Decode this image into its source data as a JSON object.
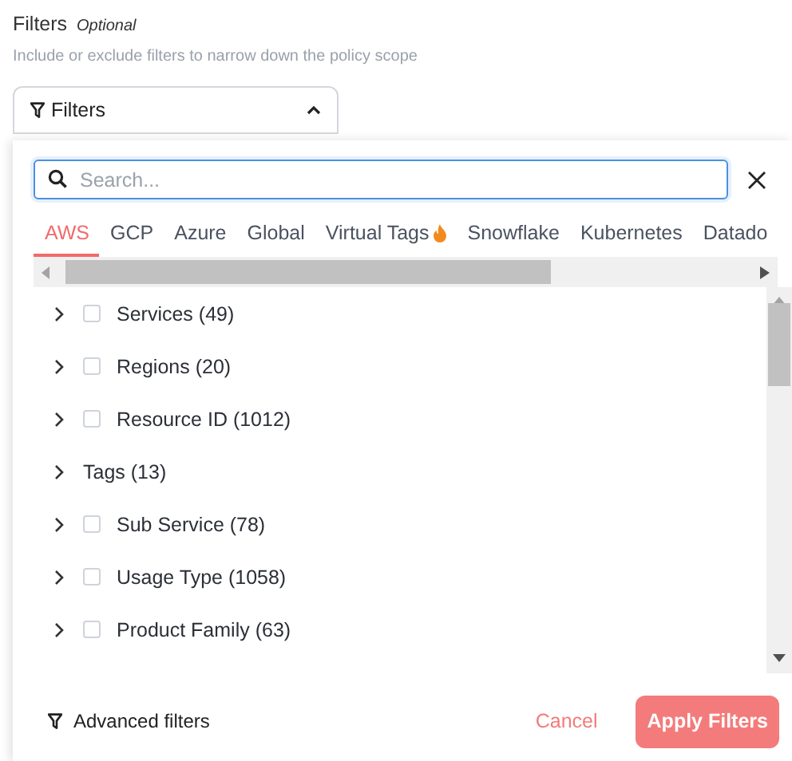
{
  "section": {
    "title": "Filters",
    "optional_label": "Optional",
    "description": "Include or exclude filters to narrow down the policy scope"
  },
  "dropdown": {
    "label": "Filters",
    "expanded": true
  },
  "search": {
    "placeholder": "Search..."
  },
  "tabs": [
    {
      "label": "AWS",
      "selected": true
    },
    {
      "label": "GCP",
      "selected": false
    },
    {
      "label": "Azure",
      "selected": false
    },
    {
      "label": "Global",
      "selected": false
    },
    {
      "label": "Virtual Tags",
      "selected": false,
      "hot": true
    },
    {
      "label": "Snowflake",
      "selected": false
    },
    {
      "label": "Kubernetes",
      "selected": false
    },
    {
      "label": "Datado",
      "selected": false
    }
  ],
  "rows": [
    {
      "label": "Services (49)",
      "kind": "checkbox",
      "checked": false
    },
    {
      "label": "Regions (20)",
      "kind": "checkbox",
      "checked": false
    },
    {
      "label": "Resource ID (1012)",
      "kind": "checkbox",
      "checked": false
    },
    {
      "label": "Tags (13)",
      "kind": "plain"
    },
    {
      "label": "Sub Service (78)",
      "kind": "checkbox",
      "checked": false
    },
    {
      "label": "Usage Type (1058)",
      "kind": "checkbox",
      "checked": false
    },
    {
      "label": "Product Family (63)",
      "kind": "checkbox",
      "checked": false
    }
  ],
  "footer": {
    "advanced": "Advanced filters",
    "cancel": "Cancel",
    "apply": "Apply Filters"
  }
}
